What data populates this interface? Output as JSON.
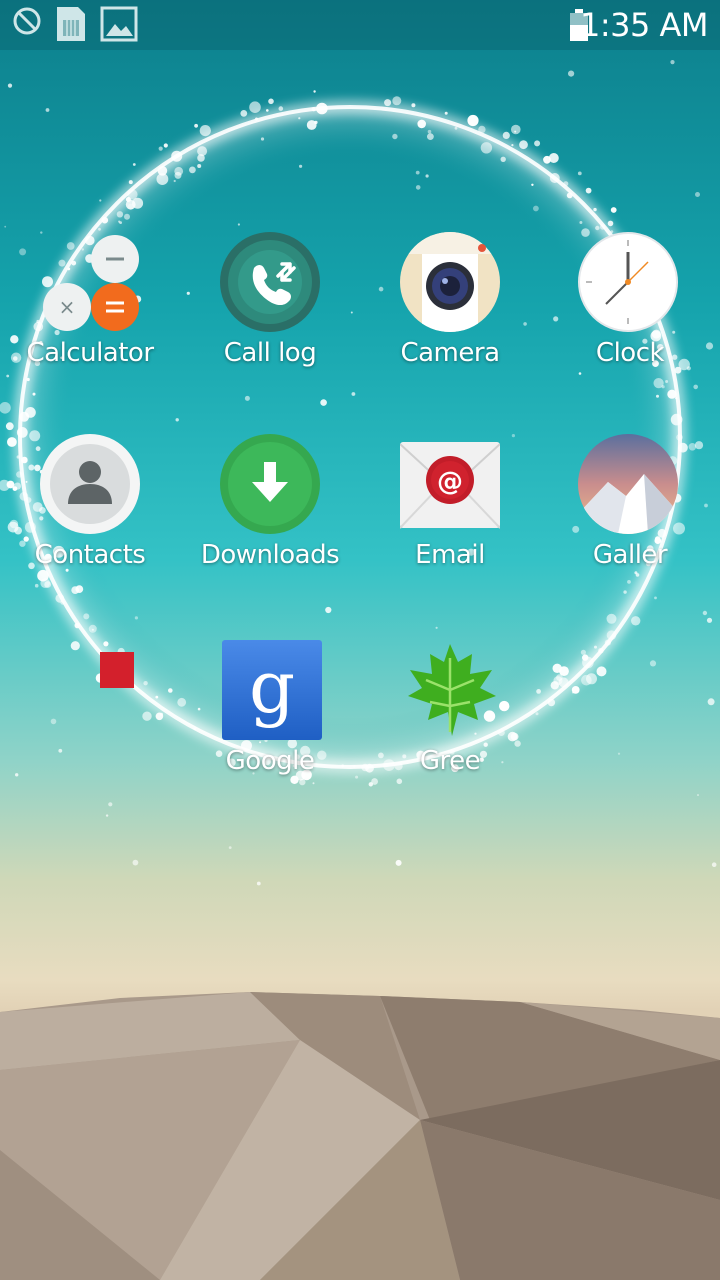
{
  "status_bar": {
    "time": "1:35 AM",
    "icons": [
      "blocked-icon",
      "sim-card-icon",
      "image-icon",
      "battery-icon"
    ]
  },
  "apps": [
    {
      "label": "Calculator",
      "icon": "calculator-icon"
    },
    {
      "label": "Call log",
      "icon": "call-log-icon"
    },
    {
      "label": "Camera",
      "icon": "camera-icon"
    },
    {
      "label": "Clock",
      "icon": "clock-icon"
    },
    {
      "label": "Contacts",
      "icon": "contacts-icon"
    },
    {
      "label": "Downloads",
      "icon": "downloads-icon"
    },
    {
      "label": "Email",
      "icon": "email-icon"
    },
    {
      "label": "Galler",
      "icon": "gallery-icon"
    },
    {
      "label": "Google",
      "icon": "google-icon"
    },
    {
      "label": "Gree",
      "icon": "greenify-icon"
    }
  ],
  "colors": {
    "calc_orange": "#f26b1d",
    "calllog_green": "#2e8a7c",
    "downloads_green": "#3db85a",
    "email_red": "#d0222e",
    "google_blue": "#2f72d8"
  }
}
